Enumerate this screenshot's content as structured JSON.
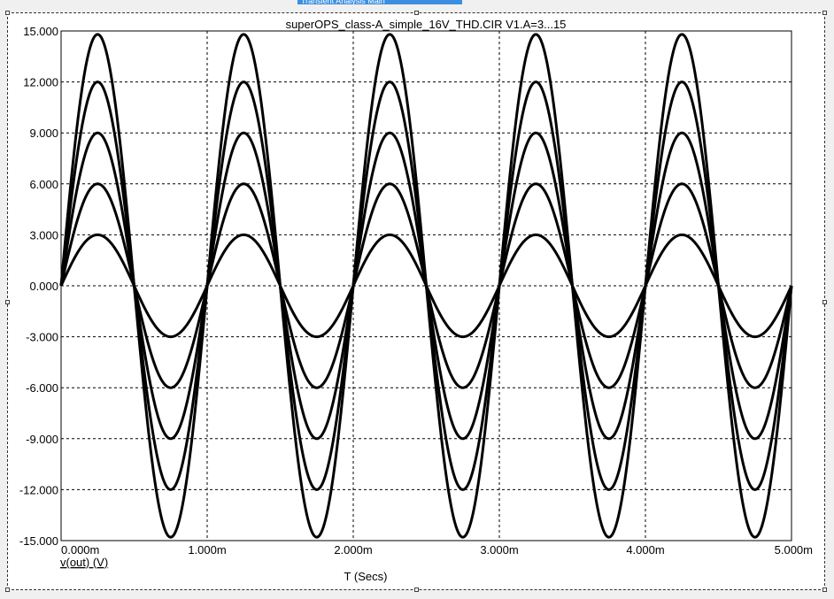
{
  "window": {
    "tab_label": "Transient Analysis Main"
  },
  "chart_data": {
    "type": "line",
    "title": "superOPS_class-A_simple_16V_THD.CIR V1.A=3...15",
    "xlabel": "T (Secs)",
    "ylabel": "v(out) (V)",
    "xlim": [
      0,
      0.005
    ],
    "ylim": [
      -15,
      15
    ],
    "grid": true,
    "x_ticks": [
      {
        "value": 0,
        "label": "0.000m"
      },
      {
        "value": 0.001,
        "label": "1.000m"
      },
      {
        "value": 0.002,
        "label": "2.000m"
      },
      {
        "value": 0.003,
        "label": "3.000m"
      },
      {
        "value": 0.004,
        "label": "4.000m"
      },
      {
        "value": 0.005,
        "label": "5.000m"
      }
    ],
    "y_ticks": [
      {
        "value": 15,
        "label": "15.000"
      },
      {
        "value": 12,
        "label": "12.000"
      },
      {
        "value": 9,
        "label": "9.000"
      },
      {
        "value": 6,
        "label": "6.000"
      },
      {
        "value": 3,
        "label": "3.000"
      },
      {
        "value": 0,
        "label": "0.000"
      },
      {
        "value": -3,
        "label": "-3.000"
      },
      {
        "value": -6,
        "label": "-6.000"
      },
      {
        "value": -9,
        "label": "-9.000"
      },
      {
        "value": -12,
        "label": "-12.000"
      },
      {
        "value": -15,
        "label": "-15.000"
      }
    ],
    "waveform": {
      "shape": "sine",
      "frequency_hz": 1000,
      "phase_deg": 0
    },
    "series": [
      {
        "amplitude": 3,
        "color": "#000000"
      },
      {
        "amplitude": 6,
        "color": "#000000"
      },
      {
        "amplitude": 9,
        "color": "#000000"
      },
      {
        "amplitude": 12,
        "color": "#000000"
      },
      {
        "amplitude": 14.8,
        "color": "#000000"
      }
    ],
    "colors": {
      "grid": "#000000",
      "axis": "#000000",
      "background": "#ffffff"
    }
  }
}
